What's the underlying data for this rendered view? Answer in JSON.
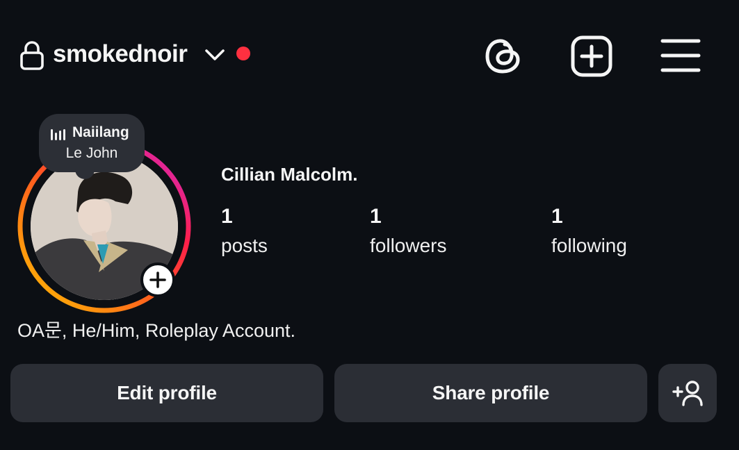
{
  "header": {
    "username": "smokednoir",
    "lock_icon": "lock-icon",
    "account_switch_icon": "chevron-down-icon",
    "notification_dot_color": "#ff3040",
    "threads_icon": "threads-icon",
    "create_icon": "add-square-icon",
    "menu_icon": "hamburger-menu-icon"
  },
  "note": {
    "icon": "music-bars-icon",
    "title": "Naiilang",
    "subtitle": "Le John"
  },
  "profile": {
    "display_name": "Cillian Malcolm.",
    "bio": "OA문, He/Him, Roleplay Account.",
    "stats": [
      {
        "value": "1",
        "label": "posts"
      },
      {
        "value": "1",
        "label": "followers"
      },
      {
        "value": "1",
        "label": "following"
      }
    ]
  },
  "actions": {
    "edit_label": "Edit profile",
    "share_label": "Share profile",
    "add_user_icon": "add-person-icon"
  },
  "colors": {
    "background": "#0c0f14",
    "button_bg": "#2b2e35",
    "story_ring_start": "#ffc400",
    "story_ring_mid": "#ff1f4a",
    "story_ring_end": "#c92bd6"
  }
}
